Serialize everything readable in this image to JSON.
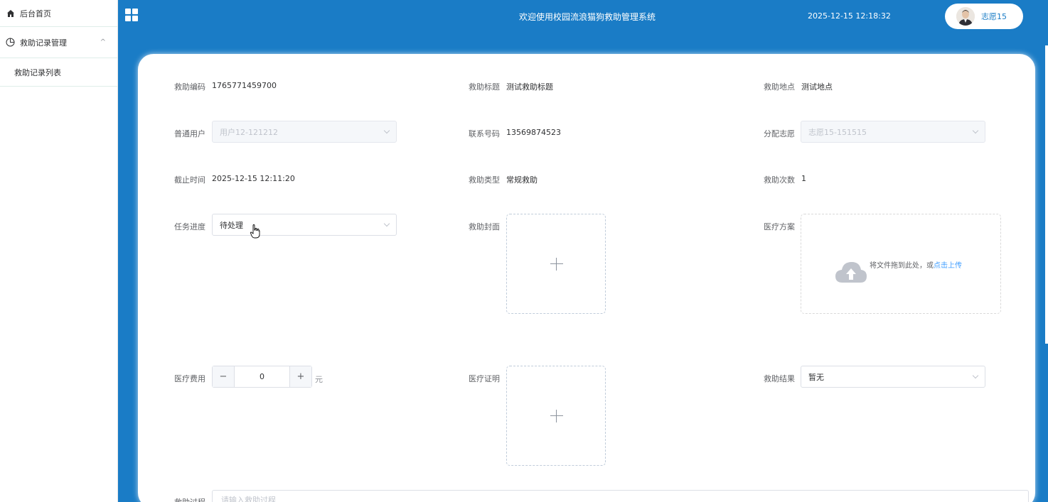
{
  "sidebar": {
    "home": "后台首页",
    "group": "救助记录管理",
    "group_chevron": "^",
    "list": "救助记录列表"
  },
  "header": {
    "title": "欢迎使用校园流浪猫狗救助管理系统",
    "time": "2025-12-15 12:18:32",
    "user": "志愿15"
  },
  "form": {
    "code": {
      "label": "救助编码",
      "value": "1765771459700"
    },
    "title": {
      "label": "救助标题",
      "value": "测试救助标题"
    },
    "location": {
      "label": "救助地点",
      "value": "测试地点"
    },
    "user": {
      "label": "普通用户",
      "value": "用户12-121212"
    },
    "phone": {
      "label": "联系号码",
      "value": "13569874523"
    },
    "volunteer": {
      "label": "分配志愿",
      "value": "志愿15-151515"
    },
    "deadline": {
      "label": "截止时间",
      "value": "2025-12-15 12:11:20"
    },
    "type": {
      "label": "救助类型",
      "value": "常规救助"
    },
    "count": {
      "label": "救助次数",
      "value": "1"
    },
    "progress": {
      "label": "任务进度",
      "value": "待处理"
    },
    "cover": {
      "label": "救助封面"
    },
    "plan": {
      "label": "医疗方案",
      "drag_text": "将文件拖到此处，或",
      "drag_link": "点击上传"
    },
    "cost": {
      "label": "医疗费用",
      "value": "0",
      "minus": "−",
      "plus": "+",
      "unit": "元"
    },
    "proof": {
      "label": "医疗证明"
    },
    "result": {
      "label": "救助结果",
      "value": "暂无"
    },
    "process": {
      "label": "救助过程",
      "placeholder": "请输入救助过程"
    }
  },
  "colors": {
    "primary": "#1a7cc6",
    "link": "#409eff"
  }
}
